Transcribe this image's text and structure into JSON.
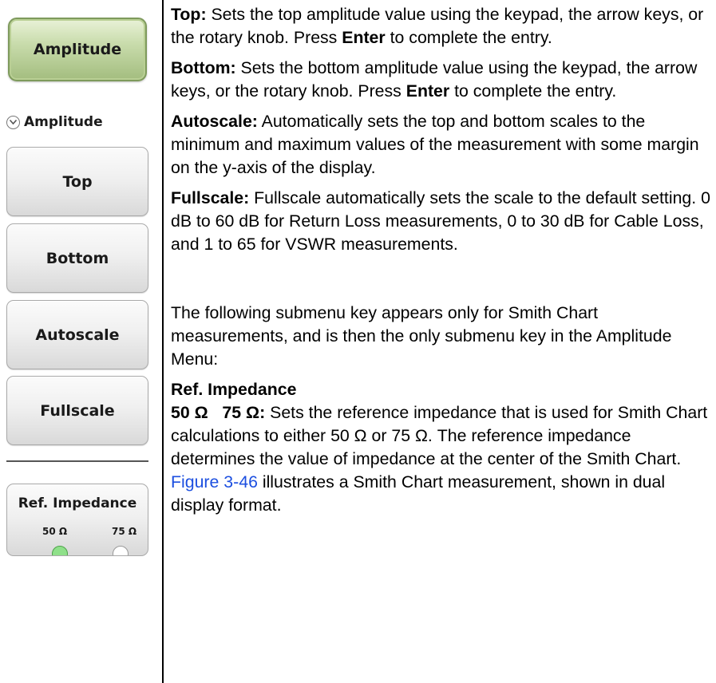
{
  "softkeys": {
    "main_key": "Amplitude",
    "section_title": "Amplitude",
    "top": "Top",
    "bottom": "Bottom",
    "autoscale": "Autoscale",
    "fullscale": "Fullscale",
    "ref_impedance": {
      "title": "Ref. Impedance",
      "options": [
        "50 Ω",
        "75 Ω"
      ],
      "selected": "50 Ω"
    }
  },
  "colors": {
    "active_key": "#b9cf94",
    "radio_on": "#8fe08a",
    "link": "#1c4fe0"
  },
  "descriptions": {
    "top": {
      "label": "Top:",
      "text1": " Sets the top amplitude value using the keypad, the arrow keys, or the rotary knob. Press ",
      "bold": "Enter",
      "text2": " to complete the entry."
    },
    "bottom": {
      "label": "Bottom:",
      "text1": " Sets the bottom amplitude value using the keypad, the arrow keys, or the rotary knob. Press ",
      "bold": "Enter",
      "text2": " to complete the entry."
    },
    "autoscale": {
      "label": "Autoscale:",
      "text": " Automatically sets the top and bottom scales to the minimum and maximum values of the measurement with some margin on the y-axis of the display."
    },
    "fullscale": {
      "label": "Fullscale:",
      "text": " Fullscale automatically sets the scale to the default setting. 0 dB to 60 dB for Return Loss measurements, 0 to 30 dB for Cable Loss, and 1 to 65 for VSWR measurements."
    },
    "submenu_note": "The following submenu key appears only for Smith Chart measurements, and is then the only submenu key in the Amplitude Menu:",
    "ref_impedance": {
      "heading": "Ref. Impedance",
      "label": "50 Ω   75 Ω:",
      "text1": " Sets the reference impedance that is used for Smith Chart calculations to either 50 Ω or 75 Ω. The reference impedance determines the value of impedance at the center of the Smith Chart. ",
      "link": "Figure 3-46",
      "text2": " illustrates a Smith Chart measurement, shown in dual display format."
    }
  }
}
